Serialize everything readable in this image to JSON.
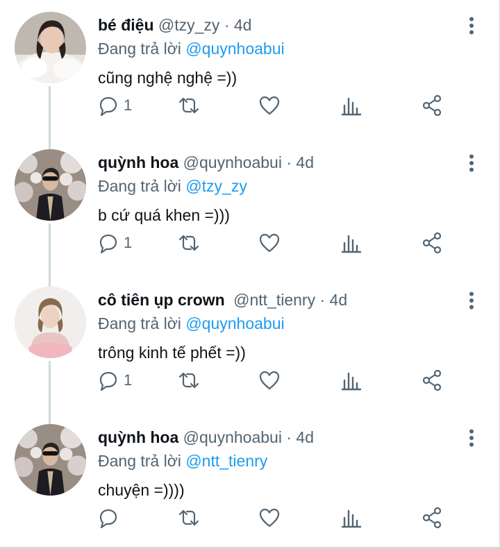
{
  "tweets": [
    {
      "name": "bé điệu",
      "handle": "@tzy_zy",
      "dot": "·",
      "time": "4d",
      "reply_prefix": "Đang trả lời",
      "reply_mention": "@quynhoabui",
      "text": "cũng nghệ nghệ =))",
      "reply_count": "1",
      "avatar": "fur-coat-woman"
    },
    {
      "name": "quỳnh hoa",
      "handle": "@quynhoabui",
      "dot": "·",
      "time": "4d",
      "reply_prefix": "Đang trả lời",
      "reply_mention": "@tzy_zy",
      "text": "b cứ quá khen =)))",
      "reply_count": "1",
      "avatar": "blossom-sunglasses-woman"
    },
    {
      "name": "cô tiên ụp crown",
      "handle": "@ntt_tienry",
      "dot": "·",
      "time": "4d",
      "reply_prefix": "Đang trả lời",
      "reply_mention": "@quynhoabui",
      "text": "trông kinh tế phết =))",
      "reply_count": "1",
      "avatar": "pink-dress-woman"
    },
    {
      "name": "quỳnh hoa",
      "handle": "@quynhoabui",
      "dot": "·",
      "time": "4d",
      "reply_prefix": "Đang trả lời",
      "reply_mention": "@ntt_tienry",
      "text": "chuyện =))))",
      "reply_count": "",
      "avatar": "blossom-sunglasses-woman"
    }
  ],
  "colors": {
    "text": "#0f1419",
    "secondary": "#536471",
    "link": "#1d9bf0",
    "thread_line": "#cfd9de"
  },
  "icons": {
    "reply": "reply-icon",
    "retweet": "retweet-icon",
    "like": "heart-icon",
    "stats": "bar-chart-icon",
    "share": "share-icon",
    "more": "more-vertical-icon"
  }
}
